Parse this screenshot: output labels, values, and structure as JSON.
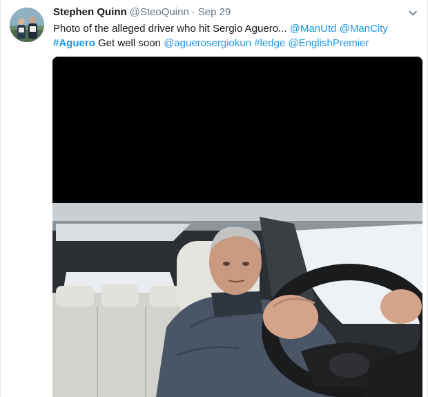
{
  "tweet": {
    "author_name": "Stephen Quinn",
    "author_handle": "@SteoQuinn",
    "separator": "·",
    "timestamp": "Sep 29",
    "text": {
      "part1": "Photo of the alleged driver who hit Sergio Aguero...",
      "mention_manutd": "@ManUtd",
      "mention_mancity": "@ManCity",
      "hashtag_aguero": "#Aguero",
      "part2": "Get well soon",
      "mention_aguerosergiokun": "@aguerosergiokun",
      "hashtag_ledge": "#ledge",
      "mention_englishpremier": "@EnglishPremier"
    },
    "icons": {
      "avatar": "avatar",
      "menu": "chevron-down-icon"
    },
    "colors": {
      "link": "#1b95e0",
      "secondary_text": "#657786",
      "primary_text": "#14171a"
    }
  }
}
